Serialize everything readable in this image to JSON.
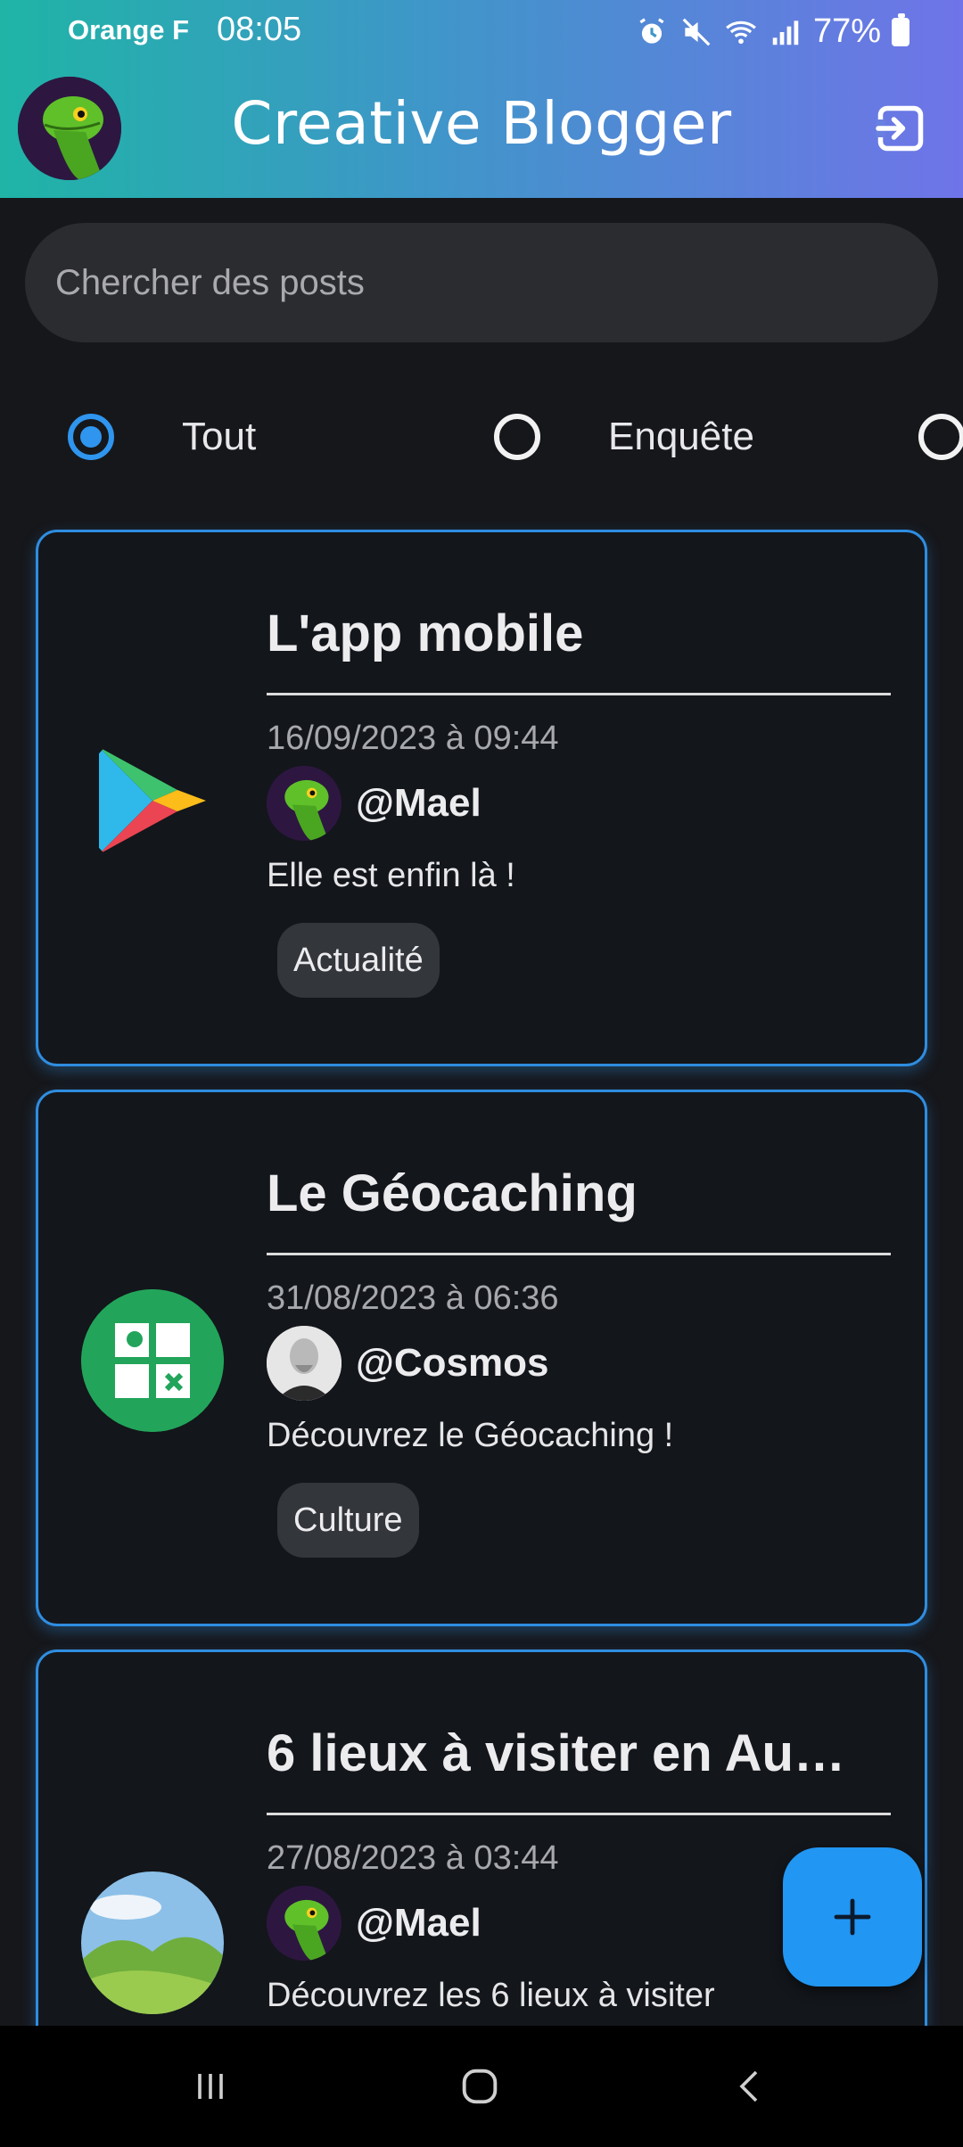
{
  "status_bar": {
    "carrier": "Orange F",
    "time": "08:05",
    "battery": "77%"
  },
  "header": {
    "title": "Creative Blogger",
    "avatar_icon": "lizard-avatar",
    "logout_icon": "logout-icon"
  },
  "search": {
    "placeholder": "Chercher des posts"
  },
  "filters": [
    {
      "label": "Tout",
      "selected": true
    },
    {
      "label": "Enquête",
      "selected": false
    },
    {
      "label": "",
      "selected": false
    }
  ],
  "posts": [
    {
      "title": "L'app mobile",
      "date": "16/09/2023 à 09:44",
      "author": "@Mael",
      "text": "Elle est enfin là !",
      "tag": "Actualité",
      "thumb_icon": "play-store-icon"
    },
    {
      "title": "Le Géocaching",
      "date": "31/08/2023 à 06:36",
      "author": "@Cosmos",
      "text": "Découvrez le Géocaching !",
      "tag": "Culture",
      "thumb_icon": "geocaching-icon"
    },
    {
      "title": "6 lieux à visiter en Au…",
      "date": "27/08/2023 à 03:44",
      "author": "@Mael",
      "text": "Découvrez les 6 lieux à visiter",
      "tag": "",
      "thumb_icon": "landscape-image"
    }
  ],
  "colors": {
    "accent": "#2196f3",
    "card_border": "#2f8de0",
    "background": "#16171b"
  }
}
